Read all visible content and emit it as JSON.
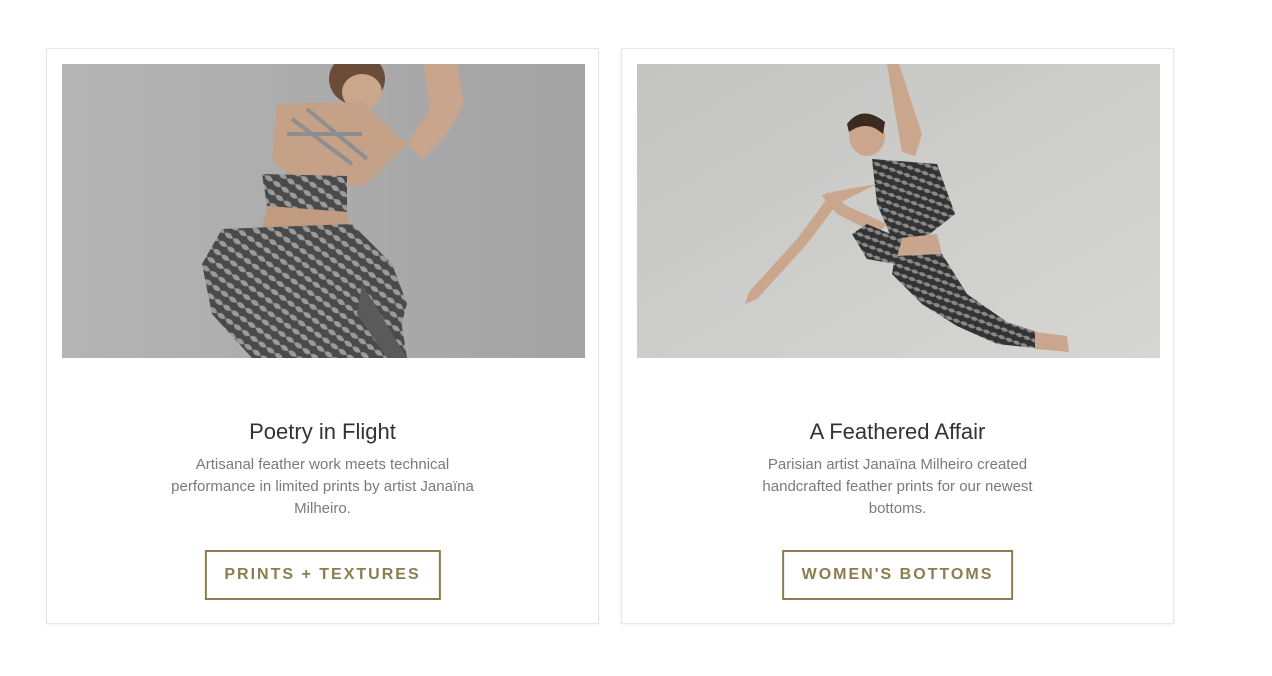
{
  "cards": [
    {
      "title": "Poetry in Flight",
      "description": "Artisanal feather work meets technical performance in limited prints by artist Janaïna Milheiro.",
      "cta_label": "PRINTS + TEXTURES"
    },
    {
      "title": "A Feathered Affair",
      "description": "Parisian artist Janaïna Milheiro created handcrafted feather prints for our newest bottoms.",
      "cta_label": "WOMEN'S BOTTOMS"
    }
  ],
  "colors": {
    "accent": "#8c7c4e",
    "title_text": "#333333",
    "body_text": "#7a7a7a",
    "card_border": "#e6e6e6"
  }
}
